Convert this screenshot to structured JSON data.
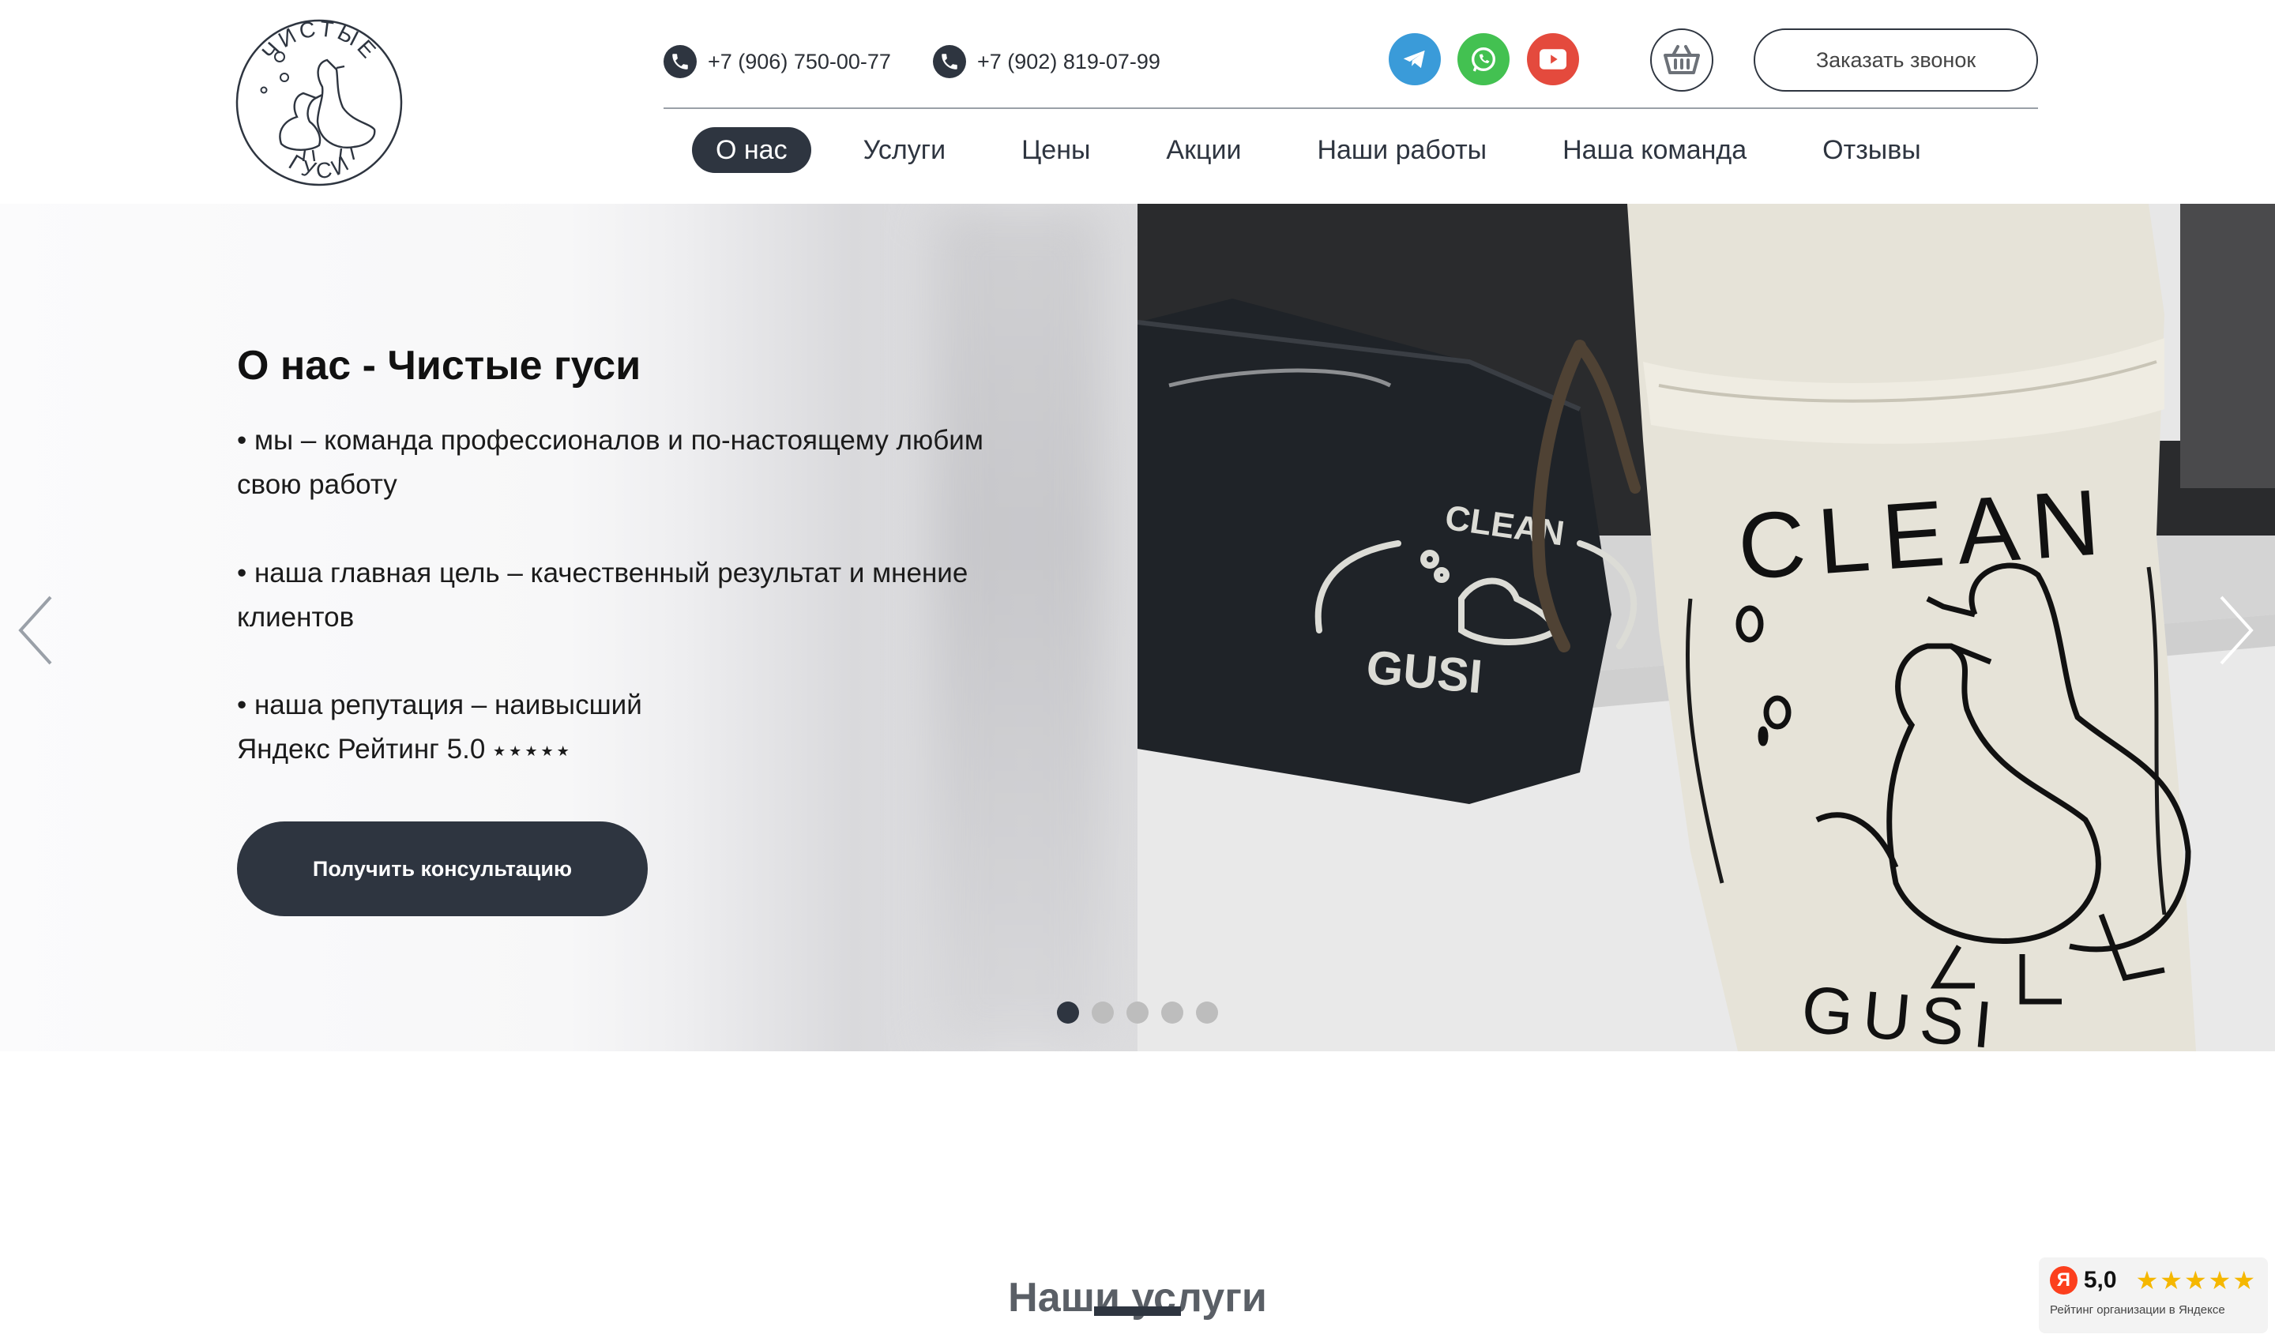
{
  "header": {
    "logo": {
      "top_text": "ЧИСТЫЕ",
      "bottom_text": "ГУСИ"
    },
    "phones": [
      "+7 (906) 750-00-77",
      "+7 (902) 819-07-99"
    ],
    "social": [
      "telegram-icon",
      "whatsapp-icon",
      "youtube-icon"
    ],
    "callback_label": "Заказать звонок",
    "nav": [
      "О нас",
      "Услуги",
      "Цены",
      "Акции",
      "Наши работы",
      "Наша команда",
      "Отзывы"
    ],
    "nav_active_index": 0
  },
  "hero": {
    "title": "О нас - Чистые гуси",
    "bullets": [
      "• мы – команда профессионалов и по-настоящему любим свою работу",
      "• наша главная цель – качественный результат и мнение клиентов",
      "• наша репутация – наивысший"
    ],
    "rating_line": "Яндекс Рейтинг 5.0",
    "rating_stars": "★★★★★",
    "cta_label": "Получить консультацию",
    "photo_text": {
      "bag": "CLEAN",
      "bag_bottom": "GUSI",
      "shirt_top": "CLEAN",
      "shirt_bottom": "GUSI"
    },
    "slides_total": 5,
    "slide_active": 1
  },
  "services": {
    "title": "Наши услуги"
  },
  "rating_badge": {
    "logo_letter": "Я",
    "score": "5,0",
    "stars": "★★★★★",
    "caption": "Рейтинг организации в Яндексе"
  },
  "colors": {
    "primary": "#2e3540",
    "telegram": "#3a9bd9",
    "whatsapp": "#43c151",
    "youtube": "#e44a3d",
    "star": "#f5b700"
  }
}
